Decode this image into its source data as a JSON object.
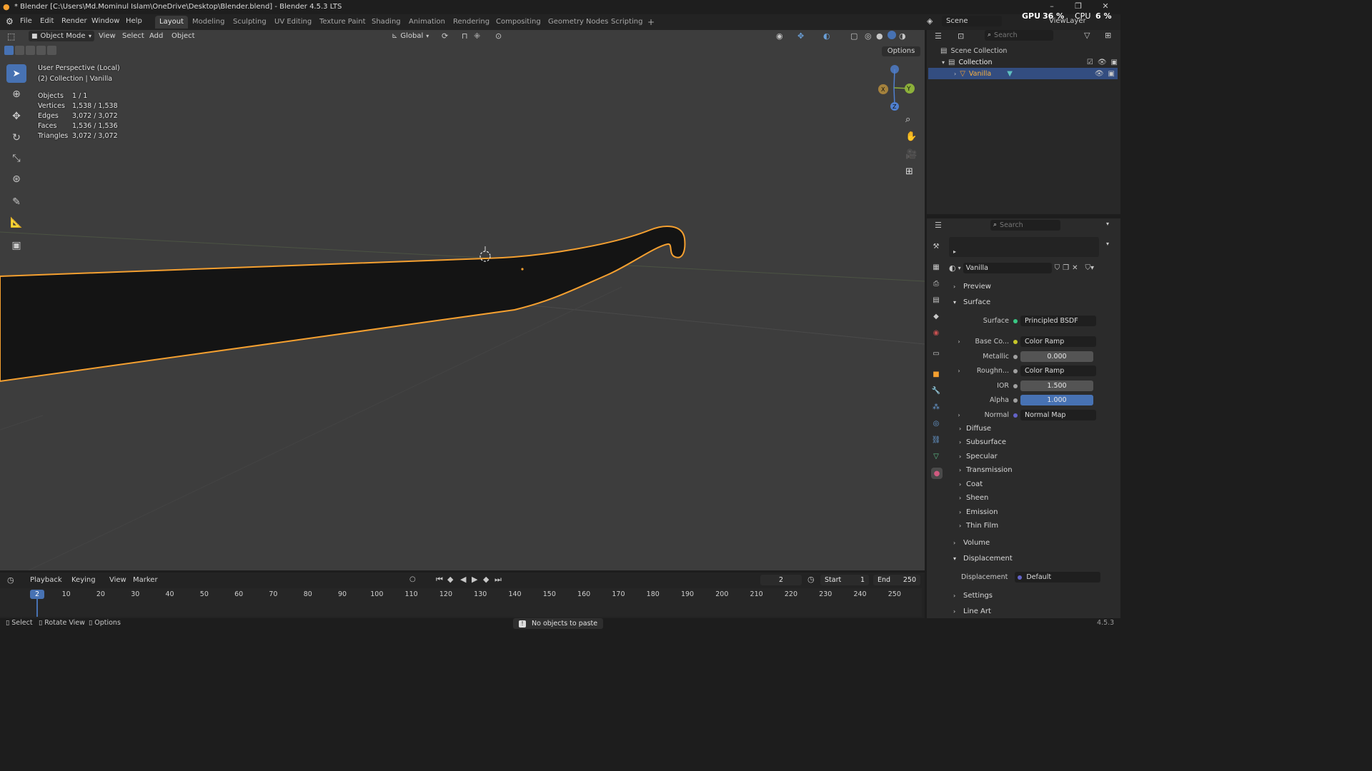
{
  "window": {
    "title": "* Blender [C:\\Users\\Md.Mominul Islam\\OneDrive\\Desktop\\Blender.blend] - Blender 4.5.3 LTS"
  },
  "menubar": {
    "items": [
      "File",
      "Edit",
      "Render",
      "Window",
      "Help"
    ],
    "workspaces": [
      "Layout",
      "Modeling",
      "Sculpting",
      "UV Editing",
      "Texture Paint",
      "Shading",
      "Animation",
      "Rendering",
      "Compositing",
      "Geometry Nodes",
      "Scripting"
    ],
    "active_workspace": "Layout",
    "add_tab": "+",
    "scene_label": "Scene",
    "viewlayer_label": "ViewLayer",
    "gpu_label": "GPU",
    "gpu_value": "36 %",
    "cpu_label": "CPU",
    "cpu_value": "6 %"
  },
  "viewport_header": {
    "mode": "Object Mode",
    "menus": [
      "View",
      "Select",
      "Add",
      "Object"
    ],
    "orientation": "Global",
    "options": "Options"
  },
  "viewport_overlay": {
    "perspective": "User Perspective (Local)",
    "collection": "(2) Collection | Vanilla",
    "stats": [
      {
        "label": "Objects",
        "value": "1 / 1"
      },
      {
        "label": "Vertices",
        "value": "1,538 / 1,538"
      },
      {
        "label": "Edges",
        "value": "3,072 / 3,072"
      },
      {
        "label": "Faces",
        "value": "1,536 / 1,536"
      },
      {
        "label": "Triangles",
        "value": "3,072 / 3,072"
      }
    ],
    "gizmo": {
      "x": "X",
      "y": "Y",
      "z": "Z"
    }
  },
  "outliner": {
    "search_placeholder": "Search",
    "scene_collection": "Scene Collection",
    "collection": "Collection",
    "object": "Vanilla"
  },
  "properties": {
    "search_placeholder": "Search",
    "material_name": "Vanilla",
    "panels": {
      "preview": "Preview",
      "surface": "Surface",
      "volume": "Volume",
      "displacement": "Displacement",
      "settings": "Settings",
      "line_art": "Line Art"
    },
    "surface_rows": [
      {
        "label": "Surface",
        "value": "Principled BSDF",
        "type": "link",
        "color": "#39c884",
        "expand": false
      },
      {
        "label": "Base Co...",
        "value": "Color Ramp",
        "type": "link",
        "color": "#c7c729",
        "expand": true
      },
      {
        "label": "Metallic",
        "value": "0.000",
        "type": "num",
        "color": "#a1a1a1",
        "expand": false
      },
      {
        "label": "Roughn...",
        "value": "Color Ramp",
        "type": "link",
        "color": "#a1a1a1",
        "expand": true
      },
      {
        "label": "IOR",
        "value": "1.500",
        "type": "num",
        "color": "#a1a1a1",
        "expand": false
      },
      {
        "label": "Alpha",
        "value": "1.000",
        "type": "num-active",
        "color": "#a1a1a1",
        "expand": false
      },
      {
        "label": "Normal",
        "value": "Normal Map",
        "type": "link",
        "color": "#6363c7",
        "expand": true
      }
    ],
    "subpanels": [
      "Diffuse",
      "Subsurface",
      "Specular",
      "Transmission",
      "Coat",
      "Sheen",
      "Emission",
      "Thin Film"
    ],
    "displacement_label": "Displacement",
    "displacement_value": "Default"
  },
  "timeline": {
    "menus": [
      "Playback",
      "Keying",
      "View",
      "Marker"
    ],
    "current_frame": "2",
    "start_label": "Start",
    "start_value": "1",
    "end_label": "End",
    "end_value": "250",
    "ruler": [
      "10",
      "20",
      "30",
      "40",
      "50",
      "60",
      "70",
      "80",
      "90",
      "100",
      "110",
      "120",
      "130",
      "140",
      "150",
      "160",
      "170",
      "180",
      "190",
      "200",
      "210",
      "220",
      "230",
      "240",
      "250"
    ],
    "playhead": "2"
  },
  "statusbar": {
    "select": "Select",
    "rotate": "Rotate View",
    "options": "Options",
    "message": "No objects to paste",
    "version": "4.5.3"
  },
  "colors": {
    "accent": "#4772b3",
    "selection_outline": "#f5a030",
    "viewport_bg": "#3d3d3d"
  }
}
